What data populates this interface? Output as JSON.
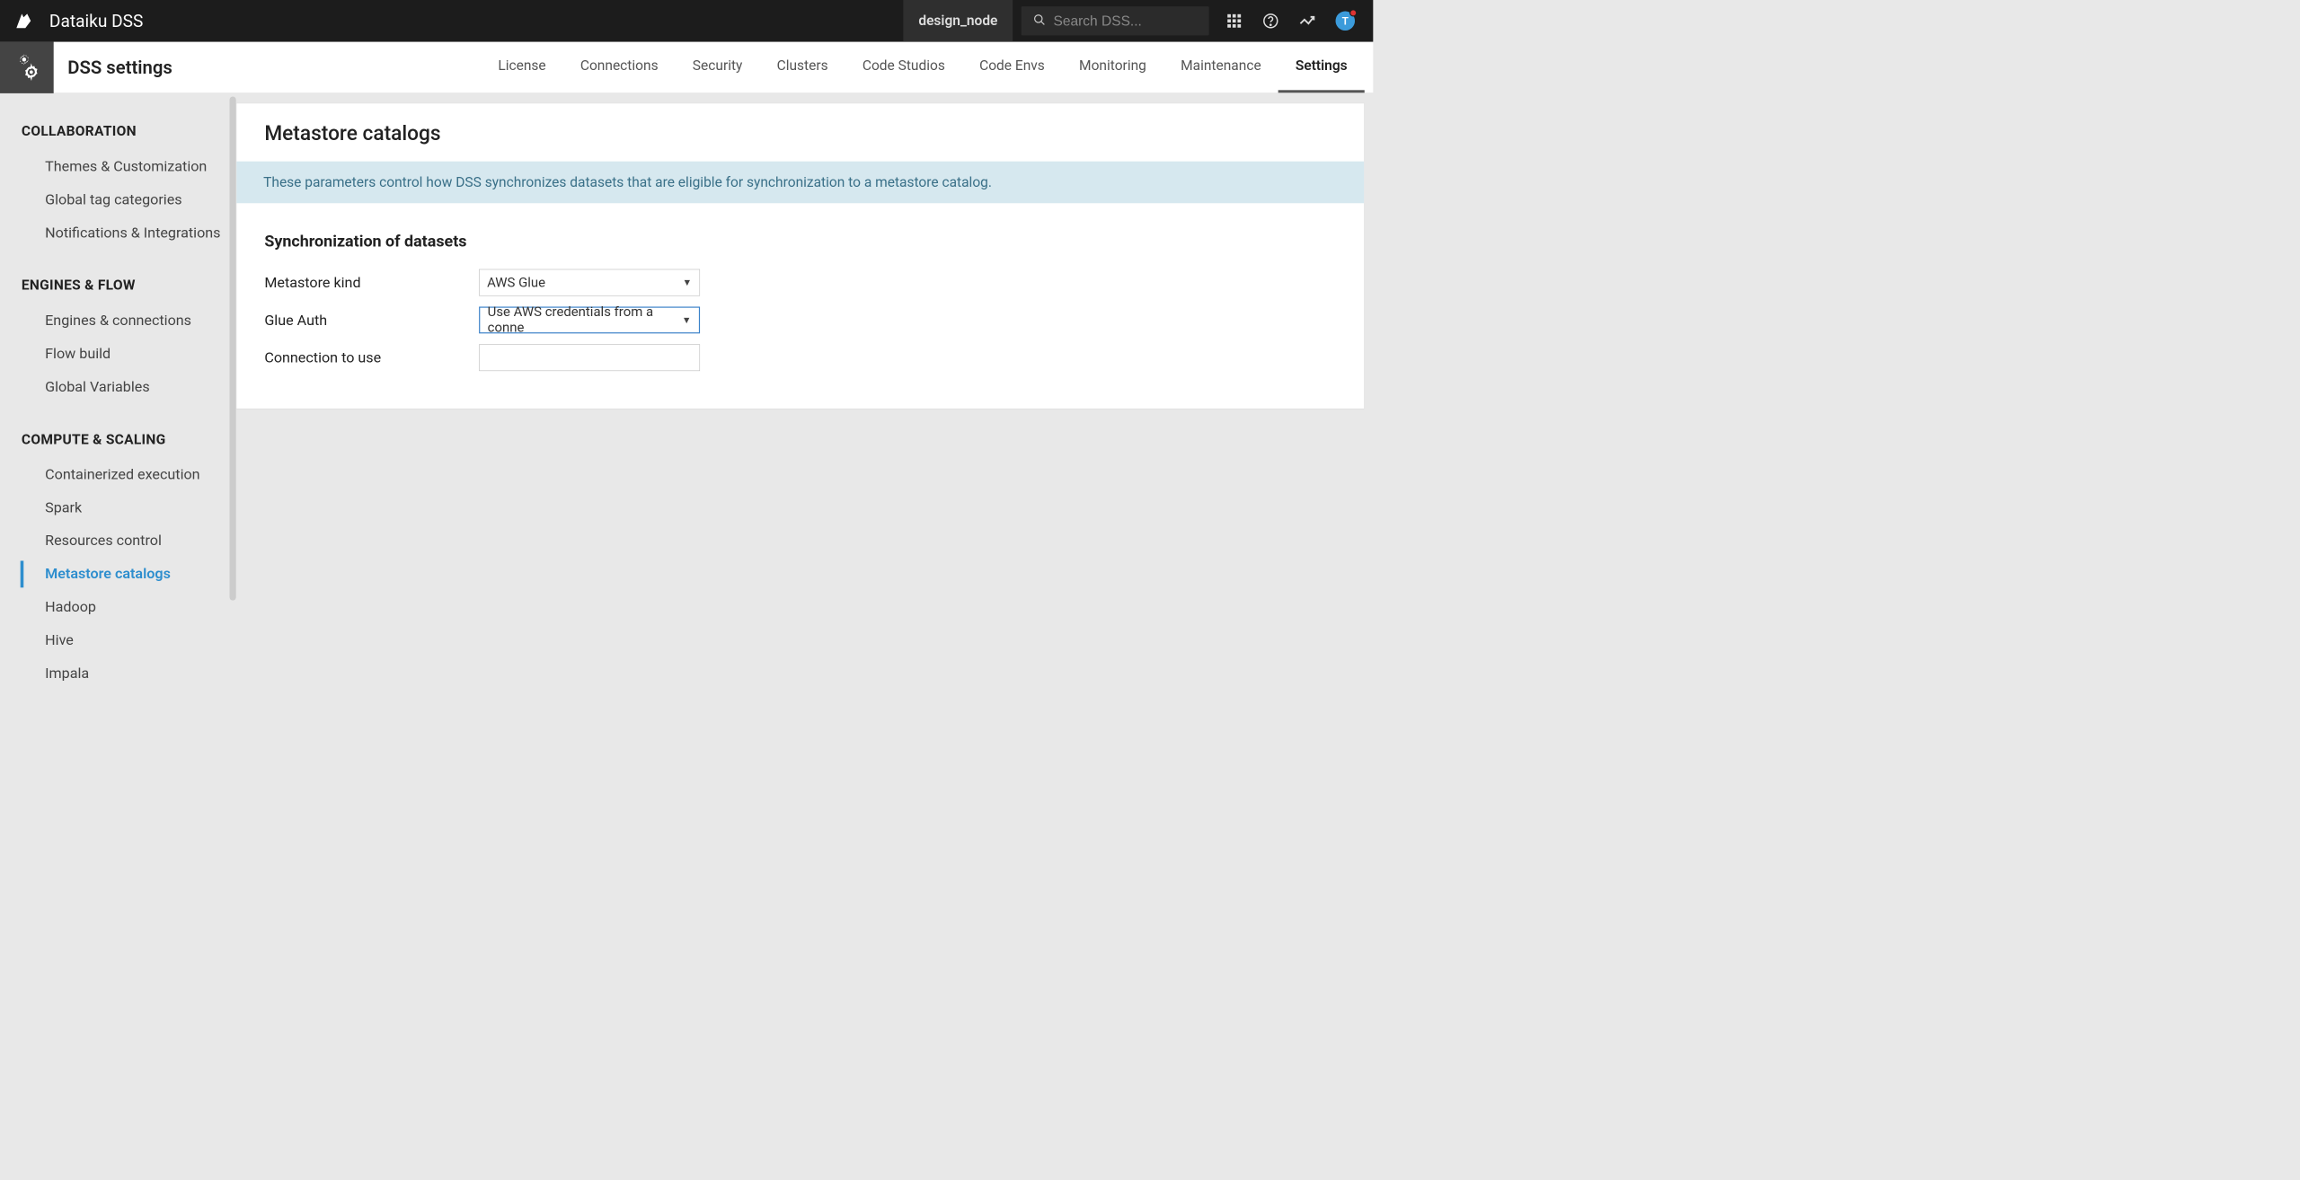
{
  "topbar": {
    "title": "Dataiku DSS",
    "node_label": "design_node",
    "search_placeholder": "Search DSS...",
    "avatar_initial": "T"
  },
  "secondbar": {
    "title": "DSS settings",
    "tabs": [
      "License",
      "Connections",
      "Security",
      "Clusters",
      "Code Studios",
      "Code Envs",
      "Monitoring",
      "Maintenance",
      "Settings"
    ],
    "active_tab": "Settings"
  },
  "sidebar": {
    "groups": [
      {
        "header": "COLLABORATION",
        "items": [
          "Themes & Customization",
          "Global tag categories",
          "Notifications & Integrations"
        ]
      },
      {
        "header": "ENGINES & FLOW",
        "items": [
          "Engines & connections",
          "Flow build",
          "Global Variables"
        ]
      },
      {
        "header": "COMPUTE & SCALING",
        "items": [
          "Containerized execution",
          "Spark",
          "Resources control",
          "Metastore catalogs",
          "Hadoop",
          "Hive",
          "Impala"
        ]
      }
    ],
    "active_item": "Metastore catalogs"
  },
  "content": {
    "panel_title": "Metastore catalogs",
    "info_banner": "These parameters control how DSS synchronizes datasets that are eligible for synchronization to a metastore catalog.",
    "section_title": "Synchronization of datasets",
    "fields": {
      "metastore_kind": {
        "label": "Metastore kind",
        "value": "AWS Glue"
      },
      "glue_auth": {
        "label": "Glue Auth",
        "value": "Use AWS credentials from a conne"
      },
      "connection": {
        "label": "Connection to use",
        "value": ""
      }
    }
  }
}
